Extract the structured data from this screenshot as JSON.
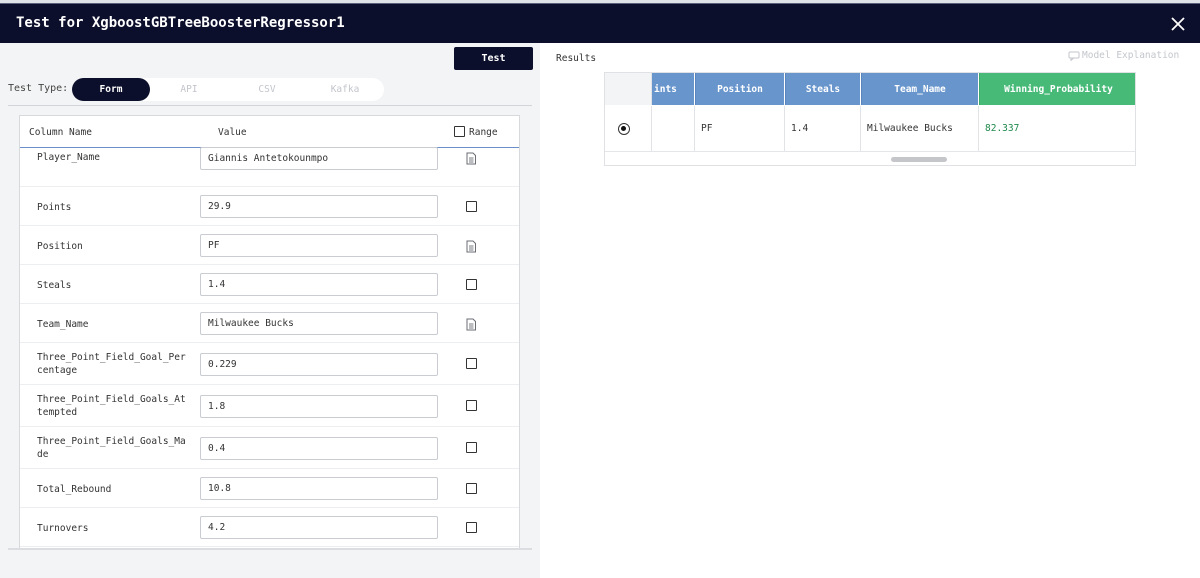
{
  "window": {
    "title": "Test for XgboostGBTreeBoosterRegressor1"
  },
  "toolbar": {
    "test_label": "Test"
  },
  "test_type": {
    "label": "Test Type:",
    "tabs": [
      "Form",
      "API",
      "CSV",
      "Kafka"
    ],
    "selected": "Form"
  },
  "form": {
    "headers": {
      "column_name": "Column Name",
      "value": "Value",
      "range": "Range"
    },
    "rows": [
      {
        "name": "Player_Name",
        "value": "Giannis Antetokounmpo",
        "kind": "text"
      },
      {
        "name": "Points",
        "value": "29.9",
        "kind": "number"
      },
      {
        "name": "Position",
        "value": "PF",
        "kind": "text"
      },
      {
        "name": "Steals",
        "value": "1.4",
        "kind": "number"
      },
      {
        "name": "Team_Name",
        "value": "Milwaukee Bucks",
        "kind": "text"
      },
      {
        "name": "Three_Point_Field_Goal_Per\ncentage",
        "value": "0.229",
        "kind": "number"
      },
      {
        "name": "Three_Point_Field_Goals_At\ntempted",
        "value": "1.8",
        "kind": "number"
      },
      {
        "name": "Three_Point_Field_Goals_Ma\nde",
        "value": "0.4",
        "kind": "number"
      },
      {
        "name": "Total_Rebound",
        "value": "10.8",
        "kind": "number"
      },
      {
        "name": "Turnovers",
        "value": "4.2",
        "kind": "number"
      }
    ]
  },
  "results": {
    "label": "Results",
    "model_explanation": "Model Explanation",
    "columns": [
      "ints",
      "Position",
      "Steals",
      "Team_Name",
      "Winning_Probability"
    ],
    "row": [
      "",
      "PF",
      "1.4",
      "Milwaukee Bucks",
      "82.337"
    ]
  },
  "colors": {
    "header_bg": "#0c0f2b",
    "column_header_blue": "#6895cc",
    "prediction_green": "#48ba78",
    "prediction_text": "#1f8a4c"
  }
}
